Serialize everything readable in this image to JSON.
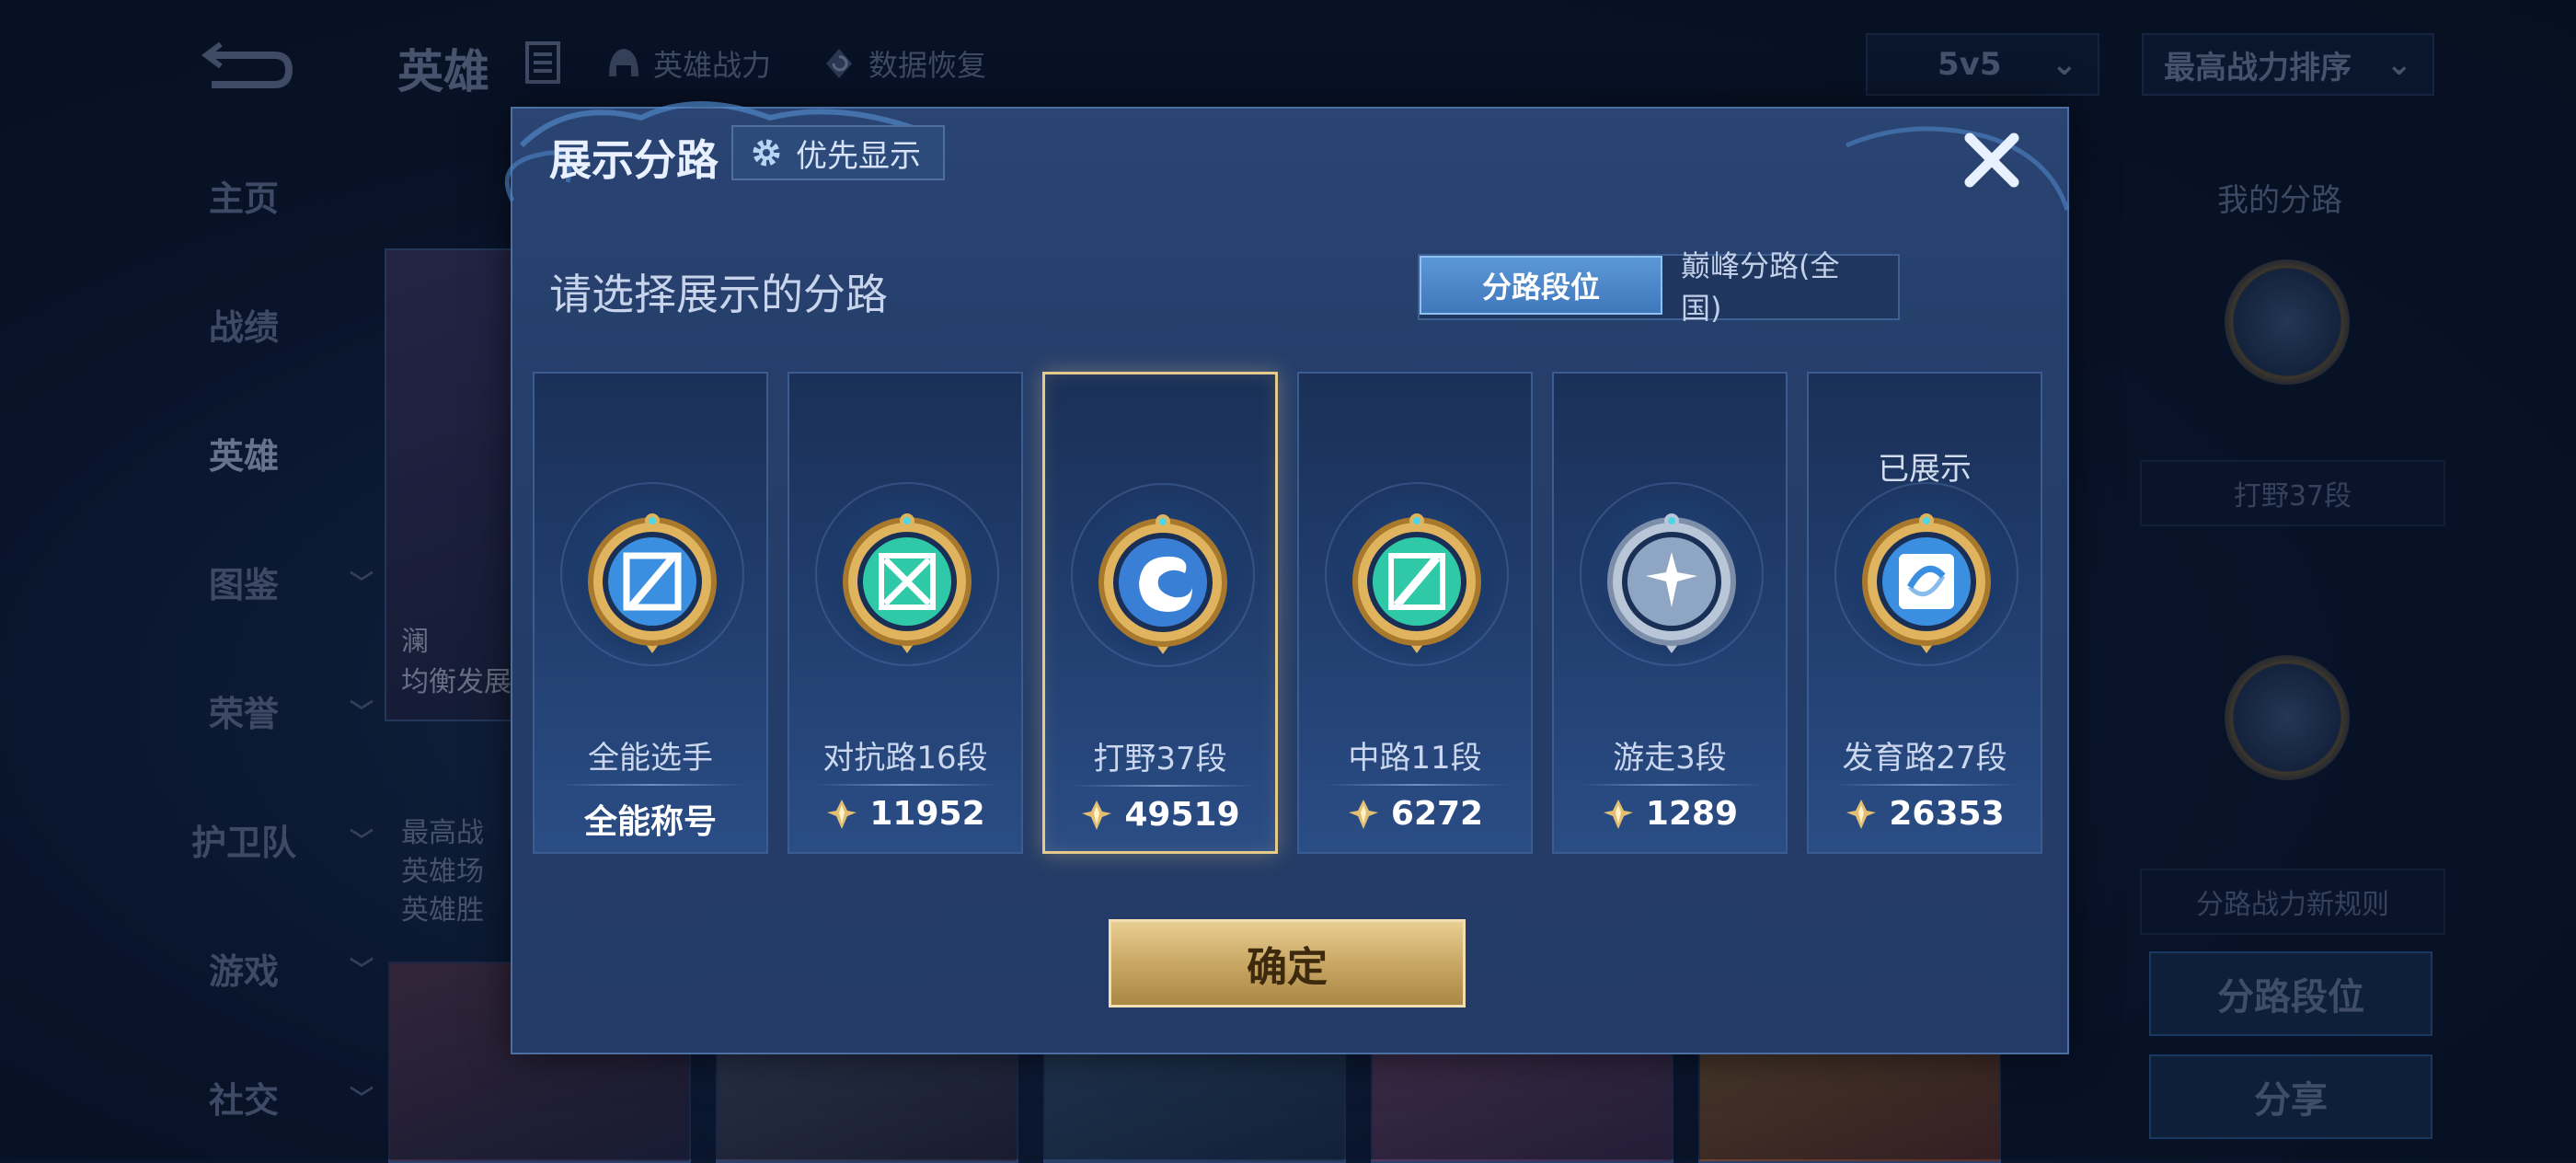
{
  "background": {
    "title": "英雄",
    "hero_power": "英雄战力",
    "data_restore": "数据恢复",
    "mode_select": "5v5",
    "sort_select": "最高战力排序",
    "nav": [
      {
        "label": "主页",
        "has_chevron": false
      },
      {
        "label": "战绩",
        "has_chevron": false
      },
      {
        "label": "英雄",
        "has_chevron": false,
        "active": true
      },
      {
        "label": "图鉴",
        "has_chevron": true
      },
      {
        "label": "荣誉",
        "has_chevron": true
      },
      {
        "label": "护卫队",
        "has_chevron": true
      },
      {
        "label": "游戏",
        "has_chevron": true
      },
      {
        "label": "社交",
        "has_chevron": true
      }
    ],
    "hero_card_lines": [
      "澜",
      "均衡发展",
      "最高战",
      "英雄场",
      "英雄胜"
    ],
    "right_panel": {
      "title": "我的分路",
      "lane_box": "打野37段",
      "rule_box": "分路战力新规则",
      "lane_rank_button": "分路段位",
      "share_button": "分享"
    }
  },
  "modal": {
    "title": "展示分路",
    "priority_button": "优先显示",
    "subtitle": "请选择展示的分路",
    "tabs": [
      {
        "label": "分路段位",
        "active": true
      },
      {
        "label": "巅峰分路(全国)",
        "active": false
      }
    ],
    "lanes": [
      {
        "name": "全能选手",
        "value": "全能称号",
        "show_power_icon": false,
        "shown_label": "",
        "emblem": "all-round-emblem-icon",
        "color": "#3b8fe0",
        "selected": false
      },
      {
        "name": "对抗路16段",
        "value": "11952",
        "show_power_icon": true,
        "shown_label": "",
        "emblem": "clash-lane-emblem-icon",
        "color": "#2fc9a8",
        "selected": false
      },
      {
        "name": "打野37段",
        "value": "49519",
        "show_power_icon": true,
        "shown_label": "",
        "emblem": "jungle-emblem-icon",
        "color": "#3a7fd6",
        "selected": true
      },
      {
        "name": "中路11段",
        "value": "6272",
        "show_power_icon": true,
        "shown_label": "",
        "emblem": "mid-lane-emblem-icon",
        "color": "#2fc9a8",
        "selected": false
      },
      {
        "name": "游走3段",
        "value": "1289",
        "show_power_icon": true,
        "shown_label": "",
        "emblem": "roam-emblem-icon",
        "color": "#8ea6c4",
        "selected": false
      },
      {
        "name": "发育路27段",
        "value": "26353",
        "show_power_icon": true,
        "shown_label": "已展示",
        "emblem": "farm-lane-emblem-icon",
        "color": "#3b8fe0",
        "selected": false
      }
    ],
    "confirm_button": "确定"
  }
}
